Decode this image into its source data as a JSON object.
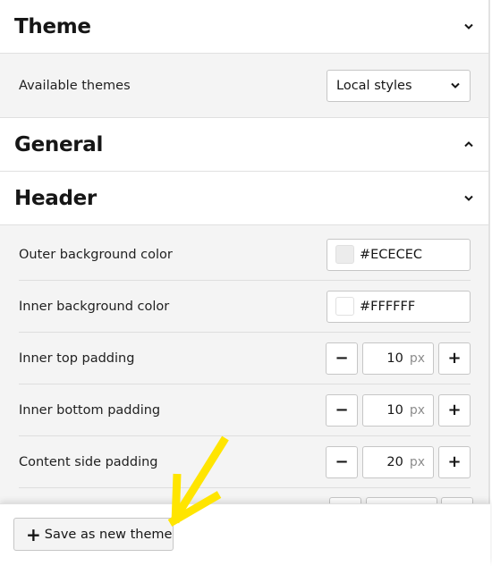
{
  "sections": {
    "theme": {
      "title": "Theme",
      "expanded": true,
      "available_themes_label": "Available themes",
      "available_themes_value": "Local styles"
    },
    "general": {
      "title": "General",
      "expanded": false
    },
    "header": {
      "title": "Header",
      "expanded": true,
      "properties": [
        {
          "label": "Outer background color",
          "type": "color",
          "value": "#ECECEC",
          "swatch": "#ECECEC"
        },
        {
          "label": "Inner background color",
          "type": "color",
          "value": "#FFFFFF",
          "swatch": "#FFFFFF"
        },
        {
          "label": "Inner top padding",
          "type": "number",
          "value": "10",
          "unit": "px",
          "minus": "−",
          "plus": "+"
        },
        {
          "label": "Inner bottom padding",
          "type": "number",
          "value": "10",
          "unit": "px",
          "minus": "−",
          "plus": "+"
        },
        {
          "label": "Content side padding",
          "type": "number",
          "value": "20",
          "unit": "px",
          "minus": "−",
          "plus": "+"
        }
      ]
    }
  },
  "footer": {
    "save_icon": "+",
    "save_label": "Save as new theme"
  },
  "annotation": {
    "arrow_color": "#FFE500"
  }
}
